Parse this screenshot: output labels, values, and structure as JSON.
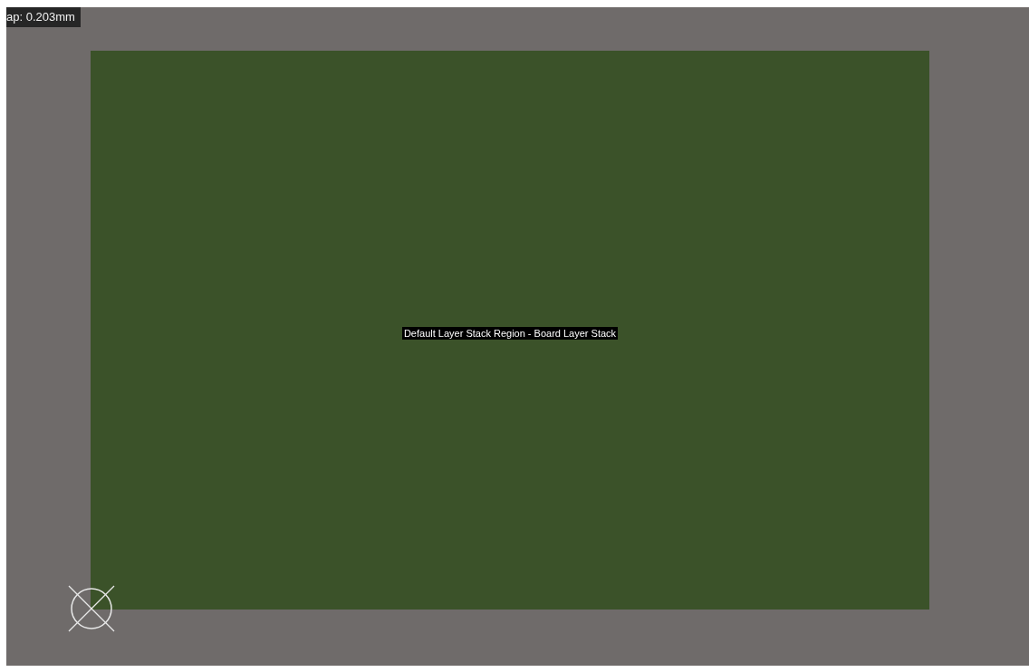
{
  "readout": "ap: 0.203mm",
  "board": {
    "label": "Default Layer Stack Region - Board Layer Stack"
  }
}
